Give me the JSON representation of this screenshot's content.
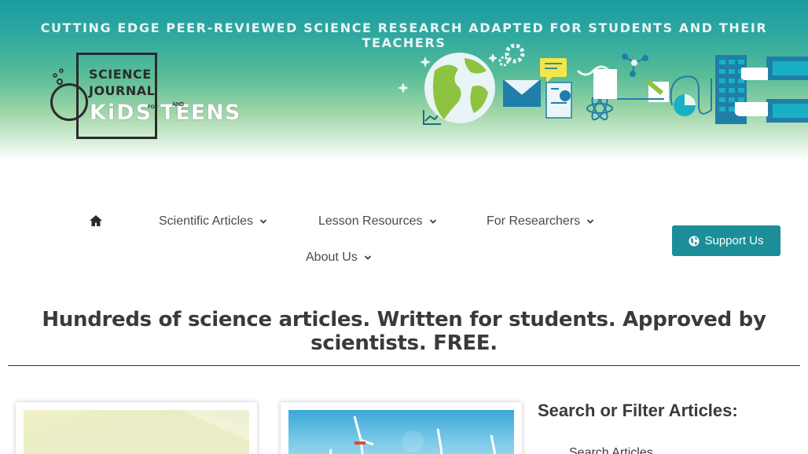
{
  "banner": {
    "tagline": "CUTTING EDGE PEER-REVIEWED SCIENCE RESEARCH ADAPTED FOR STUDENTS AND THEIR TEACHERS",
    "logo": {
      "line1": "SCIENCE",
      "line2": "JOURNAL",
      "for": "FOR",
      "kids": "KiDS",
      "and": "AND",
      "teens": "TEENS"
    },
    "illustration_icon": "science-collage-illustration"
  },
  "nav": {
    "home_icon": "home-icon",
    "items": [
      {
        "label": "Scientific Articles",
        "has_dropdown": true
      },
      {
        "label": "Lesson Resources",
        "has_dropdown": true
      },
      {
        "label": "For Researchers",
        "has_dropdown": true
      },
      {
        "label": "About Us",
        "has_dropdown": true
      }
    ]
  },
  "support_button": {
    "label": "Support Us",
    "icon": "globe-icon",
    "color": "#1b8e99"
  },
  "headline": "Hundreds of science articles. Written for students. Approved by scientists. FREE.",
  "filter": {
    "title": "Search or Filter Articles:",
    "search_label": "Search Articles"
  },
  "colors": {
    "accent": "#1b8e99",
    "banner_top": "#1a9ba0",
    "banner_mid": "#5bbd98"
  }
}
